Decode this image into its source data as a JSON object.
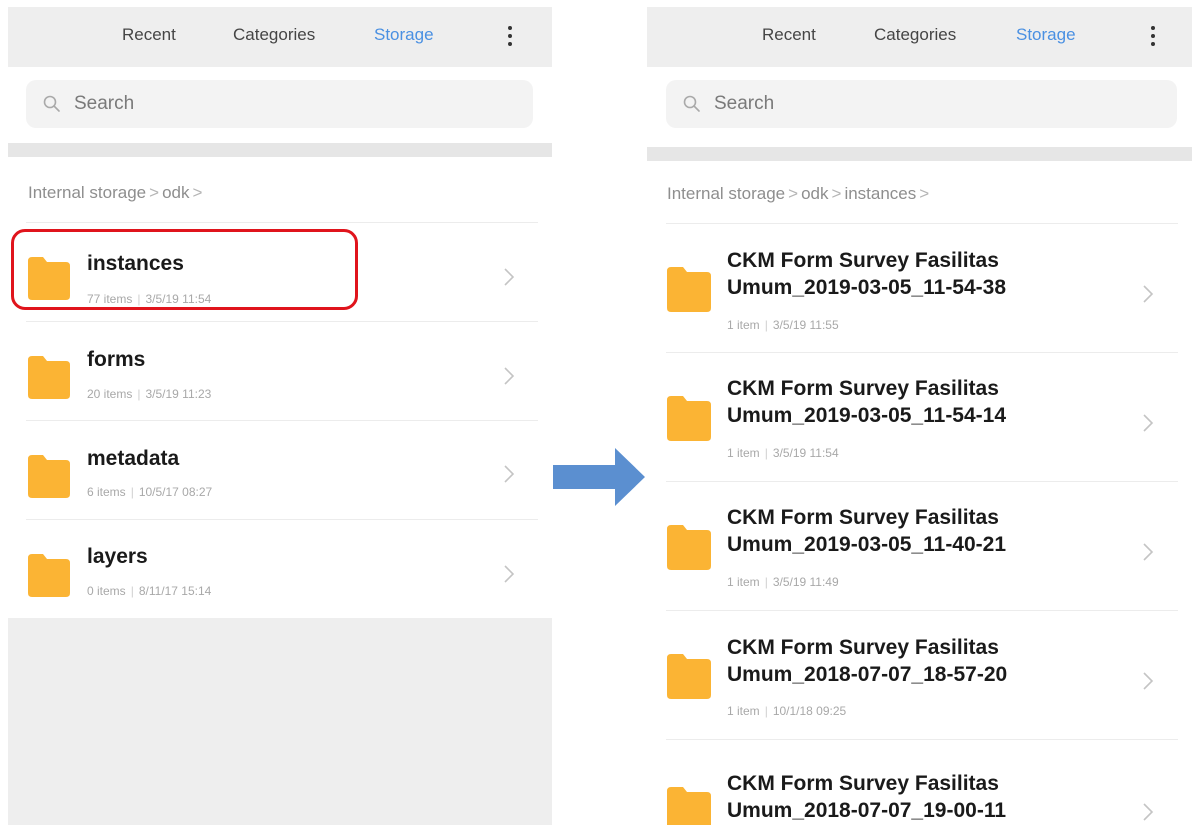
{
  "left_screen": {
    "tabs": [
      "Recent",
      "Categories",
      "Storage"
    ],
    "search_placeholder": "Search",
    "breadcrumb": [
      "Internal storage",
      "odk"
    ],
    "folders": [
      {
        "name": "instances",
        "count": "77 items",
        "date": "3/5/19 11:54"
      },
      {
        "name": "forms",
        "count": "20 items",
        "date": "3/5/19 11:23"
      },
      {
        "name": "metadata",
        "count": "6 items",
        "date": "10/5/17 08:27"
      },
      {
        "name": "layers",
        "count": "0 items",
        "date": "8/11/17 15:14"
      }
    ]
  },
  "right_screen": {
    "tabs": [
      "Recent",
      "Categories",
      "Storage"
    ],
    "search_placeholder": "Search",
    "breadcrumb": [
      "Internal storage",
      "odk",
      "instances"
    ],
    "folders": [
      {
        "line1": "CKM Form Survey Fasilitas",
        "line2": "Umum_2019-03-05_11-54-38",
        "count": "1 item",
        "date": "3/5/19 11:55"
      },
      {
        "line1": "CKM Form Survey Fasilitas",
        "line2": "Umum_2019-03-05_11-54-14",
        "count": "1 item",
        "date": "3/5/19 11:54"
      },
      {
        "line1": "CKM Form Survey Fasilitas",
        "line2": "Umum_2019-03-05_11-40-21",
        "count": "1 item",
        "date": "3/5/19 11:49"
      },
      {
        "line1": "CKM Form Survey Fasilitas",
        "line2": "Umum_2018-07-07_18-57-20",
        "count": "1 item",
        "date": "10/1/18 09:25"
      },
      {
        "line1": "CKM Form Survey Fasilitas",
        "line2": "Umum_2018-07-07_19-00-11",
        "count": "",
        "date": ""
      }
    ]
  },
  "colors": {
    "active_tab": "#4a90e2",
    "folder": "#fbb434",
    "highlight": "#e0141c",
    "arrow": "#5b8fd0"
  },
  "icons": [
    "more-vert-icon",
    "search-icon",
    "folder-icon",
    "chevron-right-icon",
    "right-arrow-icon"
  ]
}
